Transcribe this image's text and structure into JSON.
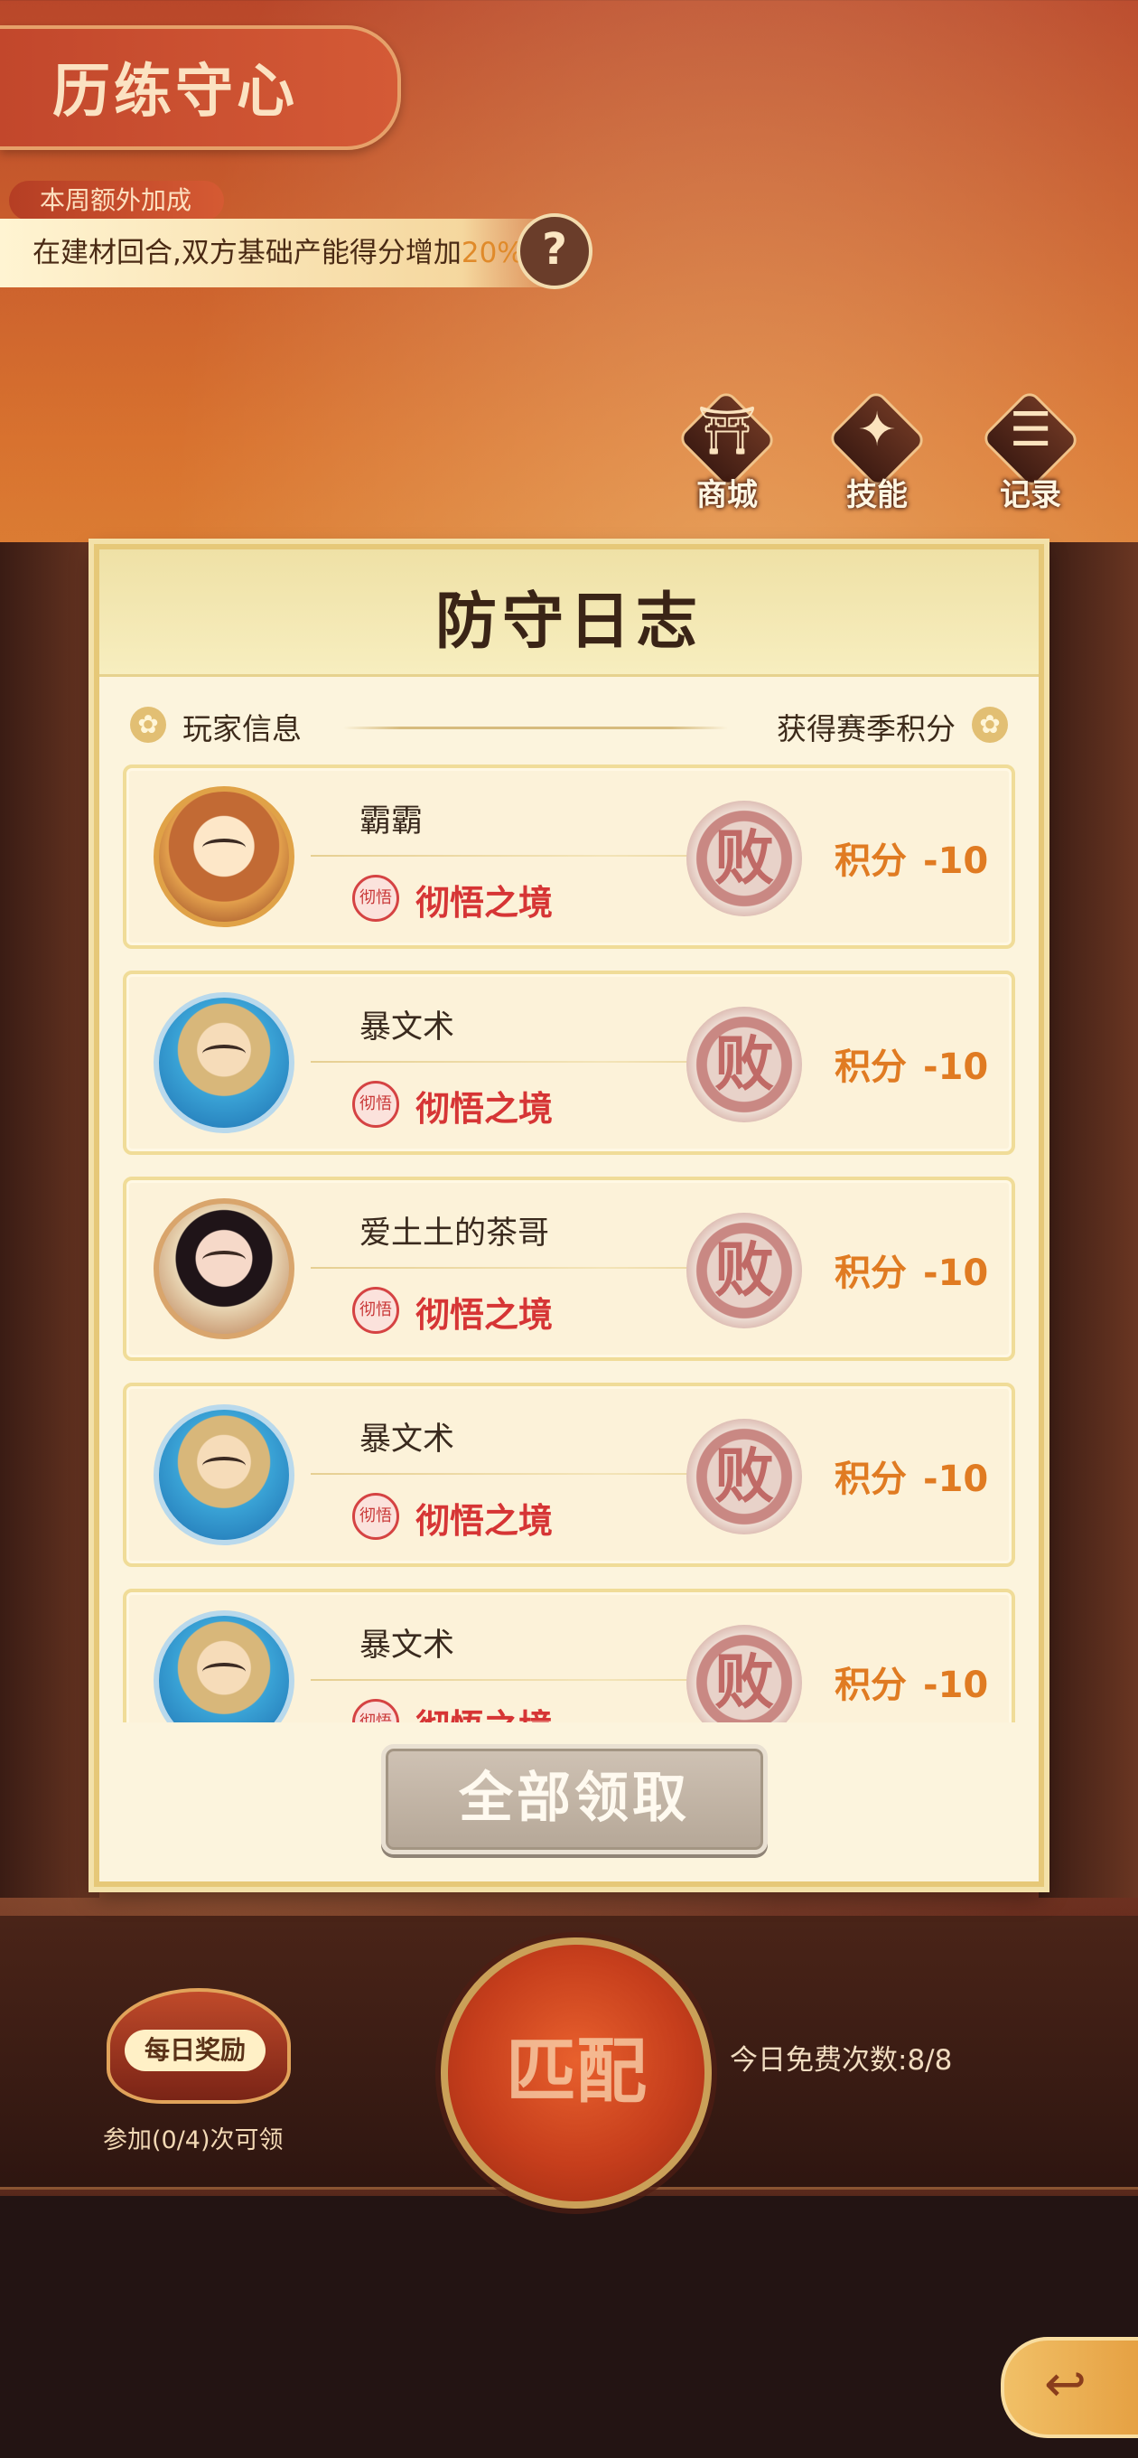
{
  "header": {
    "title": "历练守心",
    "bonus_tag": "本周额外加成",
    "bonus_text": "在建材回合,双方基础产能得分增加",
    "bonus_pct": "20%",
    "help_icon": "?"
  },
  "nav": [
    {
      "label": "商城",
      "icon": "shop-icon",
      "glyph": "⛩"
    },
    {
      "label": "技能",
      "icon": "skill-icon",
      "glyph": "✦"
    },
    {
      "label": "记录",
      "icon": "record-icon",
      "glyph": "☰"
    }
  ],
  "modal": {
    "title": "防守日志",
    "col_left": "玩家信息",
    "col_right": "获得赛季积分",
    "rows": [
      {
        "name": "霸霸",
        "realm_badge": "彻悟",
        "realm": "彻悟之境",
        "result": "败",
        "score_label": "积分",
        "score": "-10",
        "avatar": "gold"
      },
      {
        "name": "暴文术",
        "realm_badge": "彻悟",
        "realm": "彻悟之境",
        "result": "败",
        "score_label": "积分",
        "score": "-10",
        "avatar": "blue"
      },
      {
        "name": "爱土土的茶哥",
        "realm_badge": "彻悟",
        "realm": "彻悟之境",
        "result": "败",
        "score_label": "积分",
        "score": "-10",
        "avatar": "pink"
      },
      {
        "name": "暴文术",
        "realm_badge": "彻悟",
        "realm": "彻悟之境",
        "result": "败",
        "score_label": "积分",
        "score": "-10",
        "avatar": "blue"
      },
      {
        "name": "暴文术",
        "realm_badge": "彻悟",
        "realm": "彻悟之境",
        "result": "败",
        "score_label": "积分",
        "score": "-10",
        "avatar": "blue"
      }
    ],
    "claim_all": "全部领取"
  },
  "bottom": {
    "daily_label": "每日奖励",
    "daily_progress": "参加(0/4)次可领",
    "match_label": "匹配",
    "free_count": "今日免费次数:8/8"
  },
  "colors": {
    "accent_orange": "#e07b22",
    "realm_red": "#d63535",
    "panel_bg": "#fcf4dd"
  }
}
